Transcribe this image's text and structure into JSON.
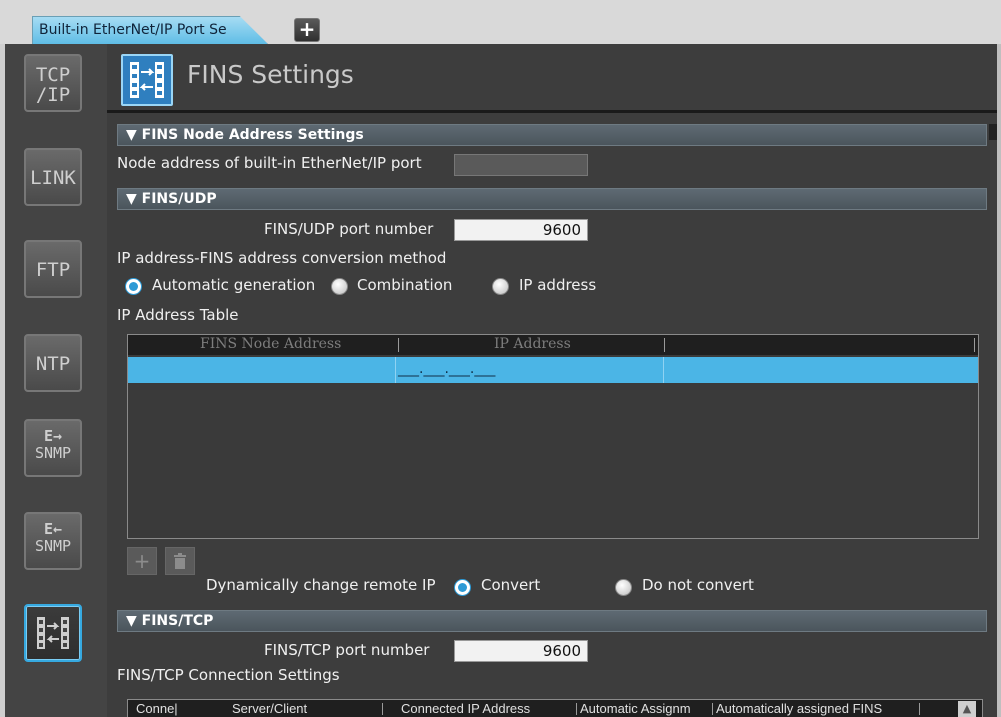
{
  "tabs": {
    "active_label": "Built-in EtherNet/IP Port Se",
    "add_label": "+"
  },
  "sidebar": {
    "items": [
      {
        "label_line1": "TCP",
        "label_line2": "/IP"
      },
      {
        "label_line1": "LINK"
      },
      {
        "label_line1": "FTP"
      },
      {
        "label_line1": "NTP"
      },
      {
        "arrow": "E→",
        "label_line1": "SNMP"
      },
      {
        "arrow": "E←",
        "label_line1": "SNMP"
      },
      {
        "icon": "fins-icon"
      }
    ]
  },
  "header": {
    "title": "FINS Settings"
  },
  "node_section": {
    "title": "▼ FINS Node Address Settings",
    "node_label": "Node address of built-in EtherNet/IP port",
    "node_value": ""
  },
  "udp_section": {
    "title": "▼ FINS/UDP",
    "port_label": "FINS/UDP port number",
    "port_value": "9600",
    "conversion_label": "IP address-FINS address conversion method",
    "options": [
      "Automatic generation",
      "Combination",
      "IP address"
    ],
    "selected": "Automatic generation",
    "table_label": "IP Address Table",
    "table_columns": [
      "FINS Node Address",
      "IP Address"
    ],
    "row_ip_placeholder": "___.___.___.___",
    "add_button": "+",
    "delete_icon": "trash-icon",
    "dynamic_label": "Dynamically change remote IP",
    "dynamic_options": [
      "Convert",
      "Do not convert"
    ],
    "dynamic_selected": "Convert"
  },
  "tcp_section": {
    "title": "▼ FINS/TCP",
    "port_label": "FINS/TCP port number",
    "port_value": "9600",
    "conn_label": "FINS/TCP Connection Settings",
    "conn_columns": [
      "Conne|",
      "Server/Client",
      "Connected IP Address",
      "Automatic Assignm",
      "Automatically assigned FINS"
    ]
  },
  "colors": {
    "accent": "#36a9e0",
    "selected_row": "#4bb5e6",
    "section_bar": "#56616a"
  }
}
